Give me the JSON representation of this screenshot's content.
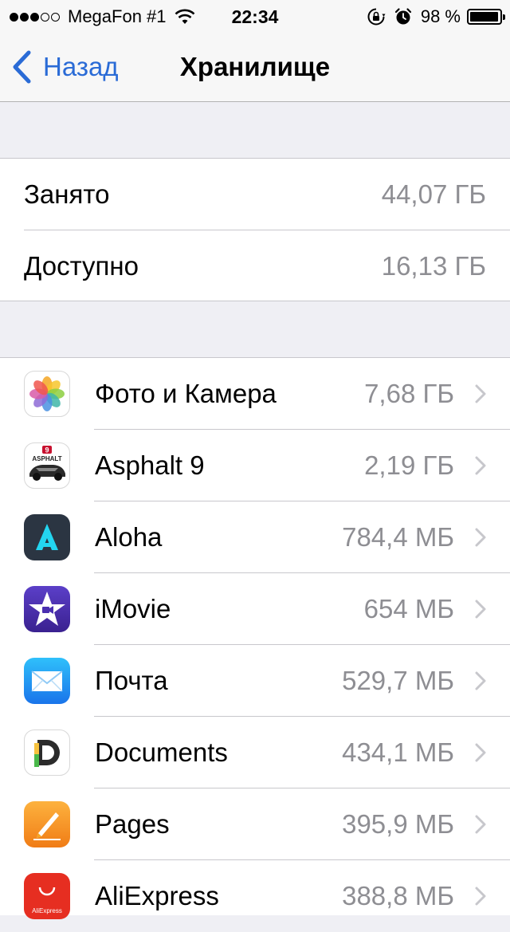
{
  "status_bar": {
    "carrier": "MegaFon #1",
    "time": "22:34",
    "battery_percent": "98 %",
    "battery_level": 0.98,
    "signal_bars_filled": 3,
    "signal_bars_total": 5
  },
  "nav": {
    "back_label": "Назад",
    "title": "Хранилище"
  },
  "summary": [
    {
      "label": "Занято",
      "value": "44,07 ГБ"
    },
    {
      "label": "Доступно",
      "value": "16,13 ГБ"
    }
  ],
  "apps": [
    {
      "name": "Фото и Камера",
      "size": "7,68 ГБ",
      "icon": "photos-icon"
    },
    {
      "name": "Asphalt 9",
      "size": "2,19 ГБ",
      "icon": "asphalt-icon"
    },
    {
      "name": "Aloha",
      "size": "784,4 МБ",
      "icon": "aloha-icon"
    },
    {
      "name": "iMovie",
      "size": "654 МБ",
      "icon": "imovie-icon"
    },
    {
      "name": "Почта",
      "size": "529,7 МБ",
      "icon": "mail-icon"
    },
    {
      "name": "Documents",
      "size": "434,1 МБ",
      "icon": "documents-icon"
    },
    {
      "name": "Pages",
      "size": "395,9 МБ",
      "icon": "pages-icon"
    },
    {
      "name": "AliExpress",
      "size": "388,8 МБ",
      "icon": "aliexpress-icon"
    }
  ],
  "icon_text": {
    "asphalt": "ASPHALT",
    "asphalt_num": "9",
    "aliexpress": "AliExpress"
  },
  "colors": {
    "accent": "#2a6bd6",
    "secondary_text": "#8e8e93",
    "background": "#efeff4"
  }
}
